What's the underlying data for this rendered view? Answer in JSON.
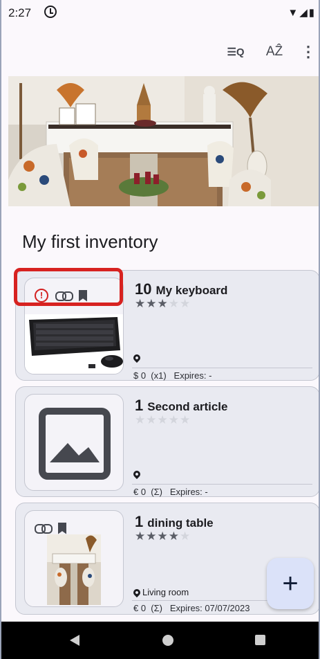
{
  "status_bar": {
    "time": "2:27",
    "right_icons": "▼◢▮"
  },
  "toolbar": {
    "search_glyph": "☰Q",
    "sort_glyph": "AẐ",
    "more_glyph": "⋮"
  },
  "inventory": {
    "title": "My first inventory"
  },
  "items": [
    {
      "quantity": "10",
      "name": "My keyboard",
      "rating": 3,
      "rating_max": 5,
      "location": "",
      "meta": "$ 0  (x1)   Expires: -",
      "flags": {
        "alert": true,
        "link": true,
        "bookmark": true
      },
      "image": "keyboard-photo"
    },
    {
      "quantity": "1",
      "name": "Second article",
      "rating": 0,
      "rating_max": 5,
      "location": "",
      "meta": "€ 0  (Σ)   Expires: -",
      "flags": {
        "alert": false,
        "link": false,
        "bookmark": false
      },
      "image": "placeholder-image-icon"
    },
    {
      "quantity": "1",
      "name": "dining table",
      "rating": 4,
      "rating_max": 5,
      "location": "Living room",
      "meta": "€ 0  (Σ)   Expires: 07/07/2023",
      "flags": {
        "alert": false,
        "link": true,
        "bookmark": true
      },
      "image": "dining-room-photo"
    }
  ],
  "alert_glyph": "!",
  "fab": {
    "glyph": "+"
  },
  "colors": {
    "card_bg": "#e9eaf1",
    "highlight": "#d72220",
    "fab_bg": "#dbe2f9",
    "alert": "#d32121"
  },
  "nav_icons": [
    "back-icon",
    "home-icon",
    "recents-icon"
  ]
}
